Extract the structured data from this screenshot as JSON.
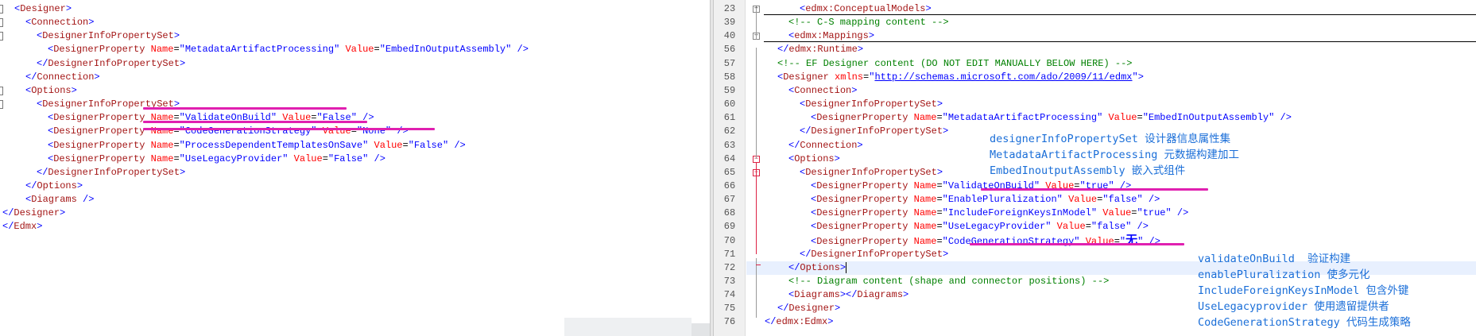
{
  "left_editor": {
    "lines": [
      "<Designer>",
      "<Connection>",
      "<DesignerInfoPropertySet>",
      "<DesignerProperty Name=\"MetadataArtifactProcessing\" Value=\"EmbedInOutputAssembly\" />",
      "</DesignerInfoPropertySet>",
      "</Connection>",
      "<Options>",
      "<DesignerInfoPropertySet>",
      "<DesignerProperty Name=\"ValidateOnBuild\" Value=\"False\" />",
      "<DesignerProperty Name=\"CodeGenerationStrategy\" Value=\"None\" />",
      "<DesignerProperty Name=\"ProcessDependentTemplatesOnSave\" Value=\"False\" />",
      "<DesignerProperty Name=\"UseLegacyProvider\" Value=\"False\" />",
      "</DesignerInfoPropertySet>",
      "</Options>",
      "<Diagrams />",
      "</Designer>",
      "</Edmx>"
    ]
  },
  "right_editor": {
    "line_numbers": [
      "23",
      "39",
      "40",
      "56",
      "57",
      "58",
      "59",
      "60",
      "61",
      "62",
      "63",
      "64",
      "65",
      "66",
      "67",
      "68",
      "69",
      "70",
      "71",
      "72",
      "73",
      "74",
      "75",
      "76"
    ],
    "lines": [
      "<edmx:ConceptualModels>",
      "<!-- C-S mapping content -->",
      "<edmx:Mappings>",
      "</edmx:Runtime>",
      "<!-- EF Designer content (DO NOT EDIT MANUALLY BELOW HERE) -->",
      "<Designer xmlns=\"http://schemas.microsoft.com/ado/2009/11/edmx\">",
      "<Connection>",
      "<DesignerInfoPropertySet>",
      "<DesignerProperty Name=\"MetadataArtifactProcessing\" Value=\"EmbedInOutputAssembly\" />",
      "</DesignerInfoPropertySet>",
      "</Connection>",
      "<Options>",
      "<DesignerInfoPropertySet>",
      "<DesignerProperty Name=\"ValidateOnBuild\" Value=\"true\" />",
      "<DesignerProperty Name=\"EnablePluralization\" Value=\"false\" />",
      "<DesignerProperty Name=\"IncludeForeignKeysInModel\" Value=\"true\" />",
      "<DesignerProperty Name=\"UseLegacyProvider\" Value=\"false\" />",
      "<DesignerProperty Name=\"CodeGenerationStrategy\" Value=\"无\" />",
      "</DesignerInfoPropertySet>",
      "</Options>",
      "<!-- Diagram content (shape and connector positions) -->",
      "<Diagrams></Diagrams>",
      "</Designer>",
      "</edmx:Edmx>"
    ]
  },
  "annotations_top": [
    "designerInfoPropertySet 设计器信息属性集",
    "MetadataArtifactProcessing 元数据构建加工",
    "EmbedInoutputAssembly 嵌入式组件"
  ],
  "annotations_bottom": [
    "validateOnBuild  验证构建",
    "enablePluralization 使多元化",
    "IncludeForeignKeysInModel 包含外键",
    "UseLegacyprovider 使用遗留提供者",
    "CodeGenerationStrategy 代码生成策略"
  ],
  "colors": {
    "tag": "#a31515",
    "bracket": "#0000ff",
    "attribute": "#ff0000",
    "value": "#0000ff",
    "comment": "#008000",
    "annotation": "#1a6ed8",
    "highlight_stroke": "#e020b0"
  }
}
